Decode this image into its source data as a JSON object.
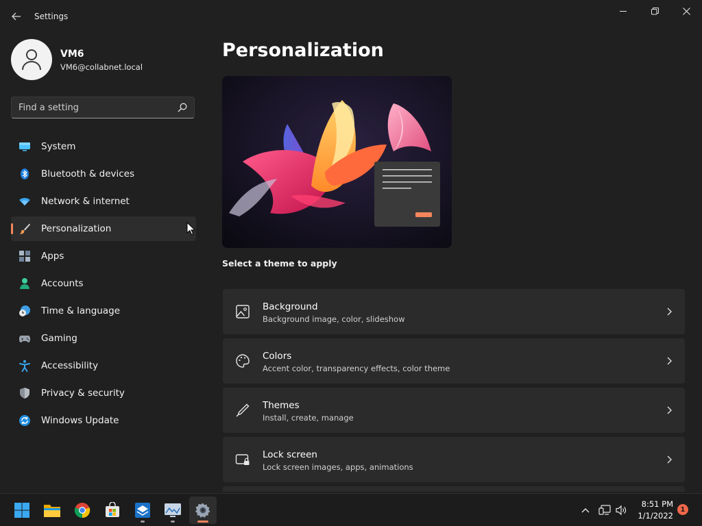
{
  "window": {
    "title": "Settings"
  },
  "profile": {
    "name": "VM6",
    "email": "VM6@collabnet.local"
  },
  "search": {
    "placeholder": "Find a setting"
  },
  "nav": {
    "items": [
      {
        "label": "System",
        "icon": "monitor-icon",
        "active": false
      },
      {
        "label": "Bluetooth & devices",
        "icon": "bluetooth-icon",
        "active": false
      },
      {
        "label": "Network & internet",
        "icon": "wifi-icon",
        "active": false
      },
      {
        "label": "Personalization",
        "icon": "brush-icon",
        "active": true
      },
      {
        "label": "Apps",
        "icon": "apps-icon",
        "active": false
      },
      {
        "label": "Accounts",
        "icon": "person-icon",
        "active": false
      },
      {
        "label": "Time & language",
        "icon": "clock-globe-icon",
        "active": false
      },
      {
        "label": "Gaming",
        "icon": "gamepad-icon",
        "active": false
      },
      {
        "label": "Accessibility",
        "icon": "accessibility-icon",
        "active": false
      },
      {
        "label": "Privacy & security",
        "icon": "shield-icon",
        "active": false
      },
      {
        "label": "Windows Update",
        "icon": "update-icon",
        "active": false
      }
    ]
  },
  "main": {
    "title": "Personalization",
    "theme_caption": "Select a theme to apply",
    "cards": [
      {
        "title": "Background",
        "subtitle": "Background image, color, slideshow",
        "icon": "image-icon"
      },
      {
        "title": "Colors",
        "subtitle": "Accent color, transparency effects, color theme",
        "icon": "palette-icon"
      },
      {
        "title": "Themes",
        "subtitle": "Install, create, manage",
        "icon": "pen-icon"
      },
      {
        "title": "Lock screen",
        "subtitle": "Lock screen images, apps, animations",
        "icon": "lock-screen-icon"
      }
    ]
  },
  "taskbar": {
    "apps": [
      "start-icon",
      "file-explorer-icon",
      "chrome-icon",
      "store-icon",
      "app-icon",
      "monitor-app-icon",
      "settings-icon"
    ],
    "time": "8:51 PM",
    "date": "1/1/2022",
    "notification_count": "1"
  },
  "colors": {
    "accent": "#f4865c",
    "background": "#202020",
    "card": "#2b2b2b"
  }
}
